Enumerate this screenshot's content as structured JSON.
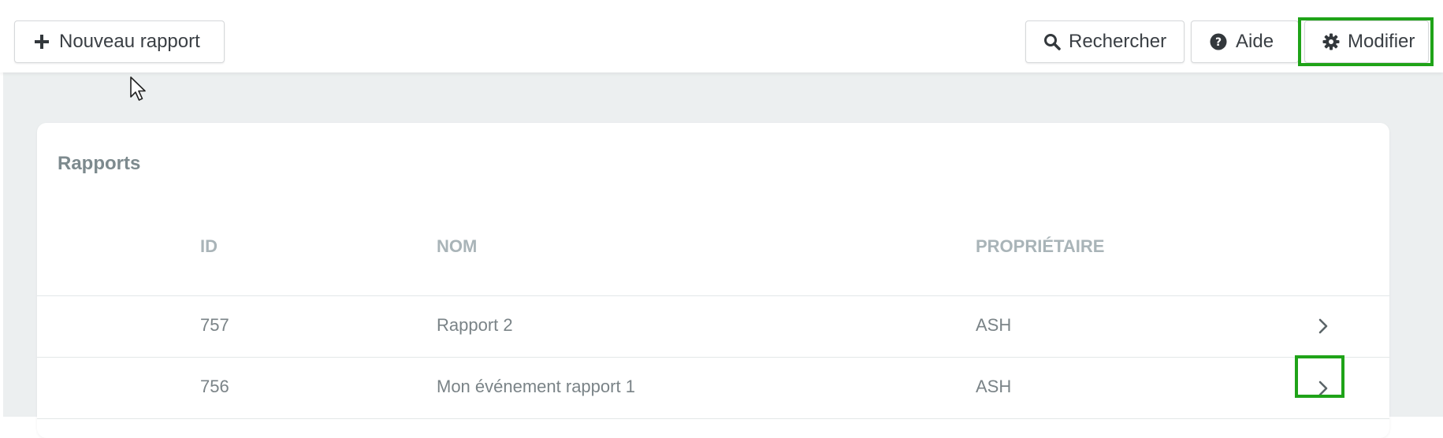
{
  "toolbar": {
    "new_report_label": "Nouveau rapport",
    "search_label": "Rechercher",
    "help_label": "Aide",
    "edit_label": "Modifier",
    "icons": {
      "new": "plus-icon",
      "search": "search-icon",
      "help": "help-circle-icon",
      "edit": "gear-icon"
    }
  },
  "reports": {
    "title": "Rapports",
    "columns": [
      "ID",
      "NOM",
      "PROPRIÉTAIRE"
    ],
    "rows": [
      {
        "id": "757",
        "name": "Rapport 2",
        "owner": "ASH"
      },
      {
        "id": "756",
        "name": "Mon événement rapport 1",
        "owner": "ASH"
      }
    ]
  },
  "colors": {
    "highlight": "#1fa318",
    "background": "#eceff0",
    "header_text": "#a9b4b8",
    "cell_text": "#7a8387"
  }
}
